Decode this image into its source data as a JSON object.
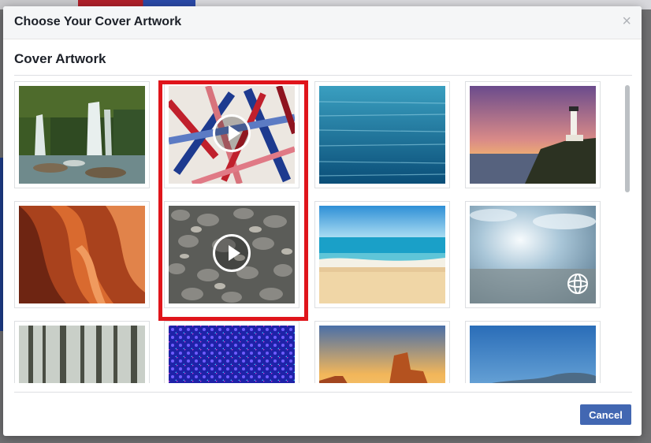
{
  "dialog": {
    "title": "Choose Your Cover Artwork",
    "close_glyph": "×",
    "section_title": "Cover Artwork",
    "cancel_label": "Cancel"
  },
  "tiles": [
    {
      "name": "waterfall-forest",
      "badge": null
    },
    {
      "name": "abstract-red-blue-strokes",
      "badge": "video"
    },
    {
      "name": "ocean-water",
      "badge": null
    },
    {
      "name": "lighthouse-sunset",
      "badge": null
    },
    {
      "name": "red-sandstone-canyon",
      "badge": null
    },
    {
      "name": "river-pebbles",
      "badge": "video"
    },
    {
      "name": "beach-shoreline",
      "badge": null
    },
    {
      "name": "misty-sky-sunburst",
      "badge": "360"
    },
    {
      "name": "foggy-forest",
      "badge": null
    },
    {
      "name": "blue-kaleidoscope-pattern",
      "badge": null
    },
    {
      "name": "desert-buttes-sunset",
      "badge": null
    },
    {
      "name": "blue-sky-hills",
      "badge": null
    }
  ],
  "colors": {
    "highlight": "#e0151b",
    "primary_button": "#4267b2"
  }
}
